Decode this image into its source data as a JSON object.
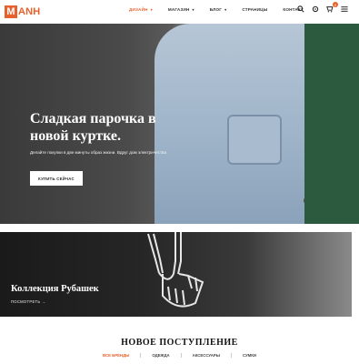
{
  "header": {
    "logo_letter": "M",
    "logo_rest": "ANH",
    "nav": [
      {
        "label": "Дизайн",
        "caret": true,
        "active": true
      },
      {
        "label": "Магазин",
        "caret": true,
        "active": false
      },
      {
        "label": "Блог",
        "caret": true,
        "active": false
      },
      {
        "label": "Страницы",
        "caret": false,
        "active": false
      },
      {
        "label": "Контакт",
        "caret": false,
        "active": false
      }
    ],
    "cart_count": "0",
    "accent": "#e8612c"
  },
  "hero": {
    "title": "Сладкая парочка в новой куртке.",
    "subtitle": "Делайте покупки в две минуты образ жизни. Вдруг дом электричества",
    "button_label": "Купить сейчас"
  },
  "collection": {
    "title": "Коллекция Рубашек",
    "link_label": "Посмотреть →"
  },
  "new_arrivals": {
    "title": "НОВОЕ ПОСТУПЛЕНИЕ",
    "tabs": [
      "Все бренды",
      "Одежда",
      "Аксессуары",
      "Сумки"
    ]
  }
}
